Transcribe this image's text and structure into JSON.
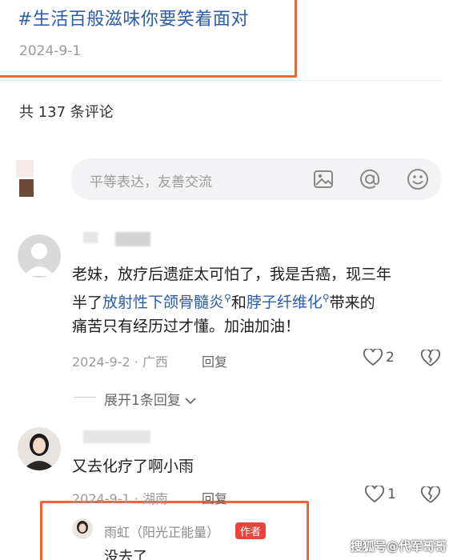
{
  "post": {
    "topic": "#生活百般滋味你要笑着面对",
    "date": "2024-9-1"
  },
  "comments_header": {
    "count_text": "共 137 条评论"
  },
  "comment_input": {
    "placeholder": "平等表达，友善交流",
    "icons": [
      "image-icon",
      "at-icon",
      "emoji-icon"
    ]
  },
  "comments": [
    {
      "text_line1": "老妹，放疗后遗症太可怕了，我是舌癌，现三年",
      "text_line2_a": "半了",
      "link1": "放射性下颌骨髓炎",
      "text_line2_b": "和",
      "link2": "脖子纤维化",
      "text_line2_c": "带来的",
      "text_line3": "痛苦只有经历过才懂。加油加油！",
      "meta": "2024-9-2 · 广西",
      "reply_label": "回复",
      "likes": "2",
      "expand_label": "展开1条回复"
    },
    {
      "text": "又去化疗了啊小雨",
      "meta": "2024-9-1 · 湖南",
      "reply_label": "回复",
      "likes": "1"
    }
  ],
  "reply": {
    "name": "雨虹（阳光正能量）",
    "badge": "作者",
    "text": "没去了"
  },
  "watermark": "搜狐号@代军哥哥",
  "colors": {
    "link": "#2d5cab",
    "highlight": "#e8673a",
    "badge": "#e8443b"
  }
}
